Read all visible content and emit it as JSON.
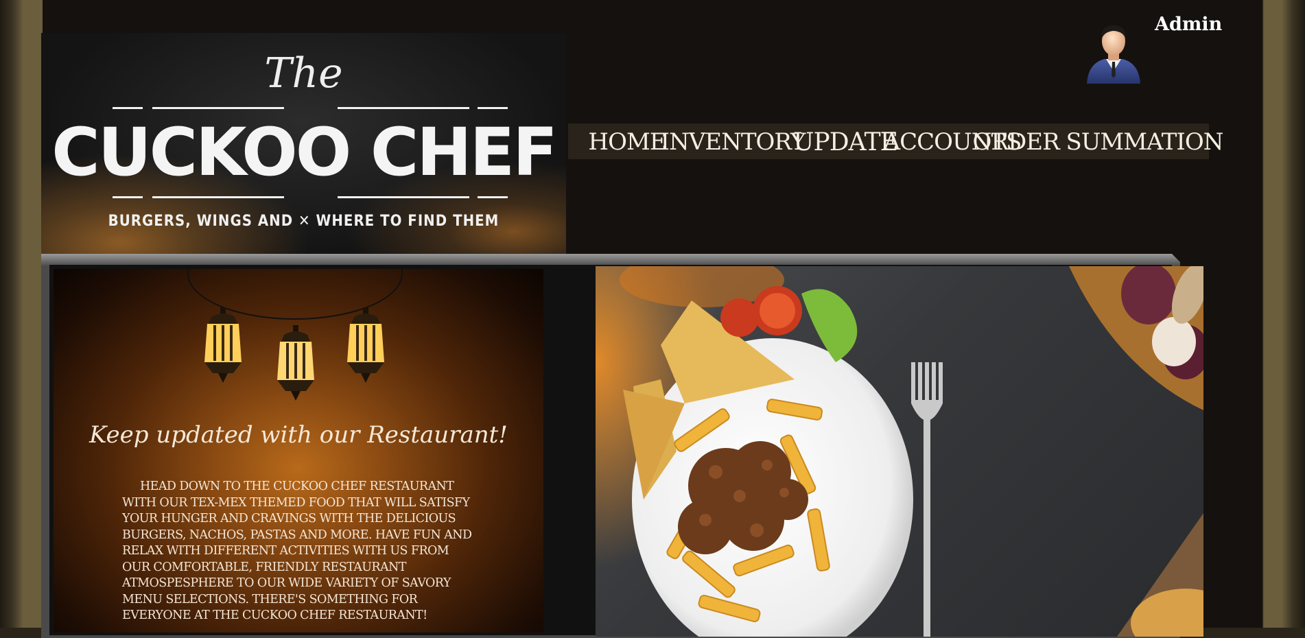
{
  "header": {
    "logo": {
      "the": "The",
      "name": "CUCKOO CHEF",
      "tagline": "BURGERS, WINGS AND ✕ WHERE TO FIND THEM"
    },
    "admin": {
      "label": "Admin",
      "icon": "admin-avatar-icon"
    }
  },
  "nav": {
    "items": [
      {
        "label": "HOME"
      },
      {
        "label": "INVENTORY"
      },
      {
        "label": "UPDATE"
      },
      {
        "label": "ACCOUNTS"
      },
      {
        "label": "ORDER SUMMATION"
      }
    ]
  },
  "main": {
    "promo": {
      "title": "Keep updated with our Restaurant!",
      "body": "Head down to the Cuckoo Chef restaurant with our Tex-Mex themed food that will satisfy your hunger and cravings with the delicious burgers, nachos, pastas and more. Have fun and relax with different activities with us from our comfortable, friendly restaurant atmospesphere to our wide variety of savory menu selections. There's something for everyone at the Cuckoo Chef restaurant!"
    },
    "photo": {
      "subject": "plate-of-penne-with-ground-meat-and-garlic-toast"
    }
  },
  "colors": {
    "background": "#15110e",
    "frame": "#6b5e3d",
    "nav_bg": "#2a231b",
    "nav_text": "#f4efe3"
  }
}
